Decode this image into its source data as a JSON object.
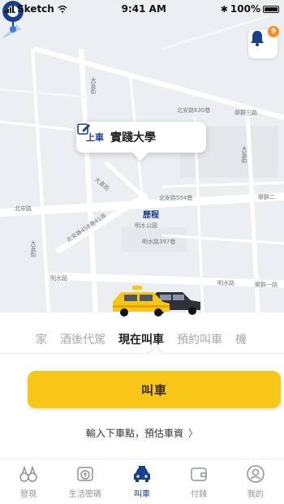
{
  "status": {
    "carrier": "Sketch",
    "time": "9:41 AM",
    "battery": "100%"
  },
  "map": {
    "labels": {
      "road_a": "北安路630巷",
      "road_b": "樂群三路",
      "road_c": "北安路554巷",
      "road_d": "樂群二",
      "road_e": "北安路",
      "road_f": "北安路458巷41弄",
      "road_g": "明水路",
      "road_h": "明水路",
      "road_i": "樂群一路",
      "road_j": "大直街",
      "road_k": "大直街",
      "road_l": "大直街",
      "road_m": "大直街",
      "park": "明水公園",
      "road_n": "明水路397巷"
    },
    "notification_count": "9"
  },
  "pickup": {
    "tag": "上車",
    "place": "實踐大學"
  },
  "marker": {
    "label": "歷程"
  },
  "services": {
    "items": [
      "家",
      "酒後代駕",
      "現在叫車",
      "預約叫車",
      "機"
    ],
    "active_index": 2
  },
  "actions": {
    "call_label": "叫車",
    "destination_link": "輸入下車點，預估車資"
  },
  "tabs": [
    {
      "label": "發現",
      "icon": "binoculars-icon"
    },
    {
      "label": "生活密碼",
      "icon": "coupon-icon"
    },
    {
      "label": "叫車",
      "icon": "taxi-icon"
    },
    {
      "label": "付錢",
      "icon": "wallet-icon"
    },
    {
      "label": "我的",
      "icon": "profile-icon"
    }
  ],
  "colors": {
    "accent": "#f7c617",
    "brand": "#1a3f91",
    "badge": "#ff8a1f"
  }
}
